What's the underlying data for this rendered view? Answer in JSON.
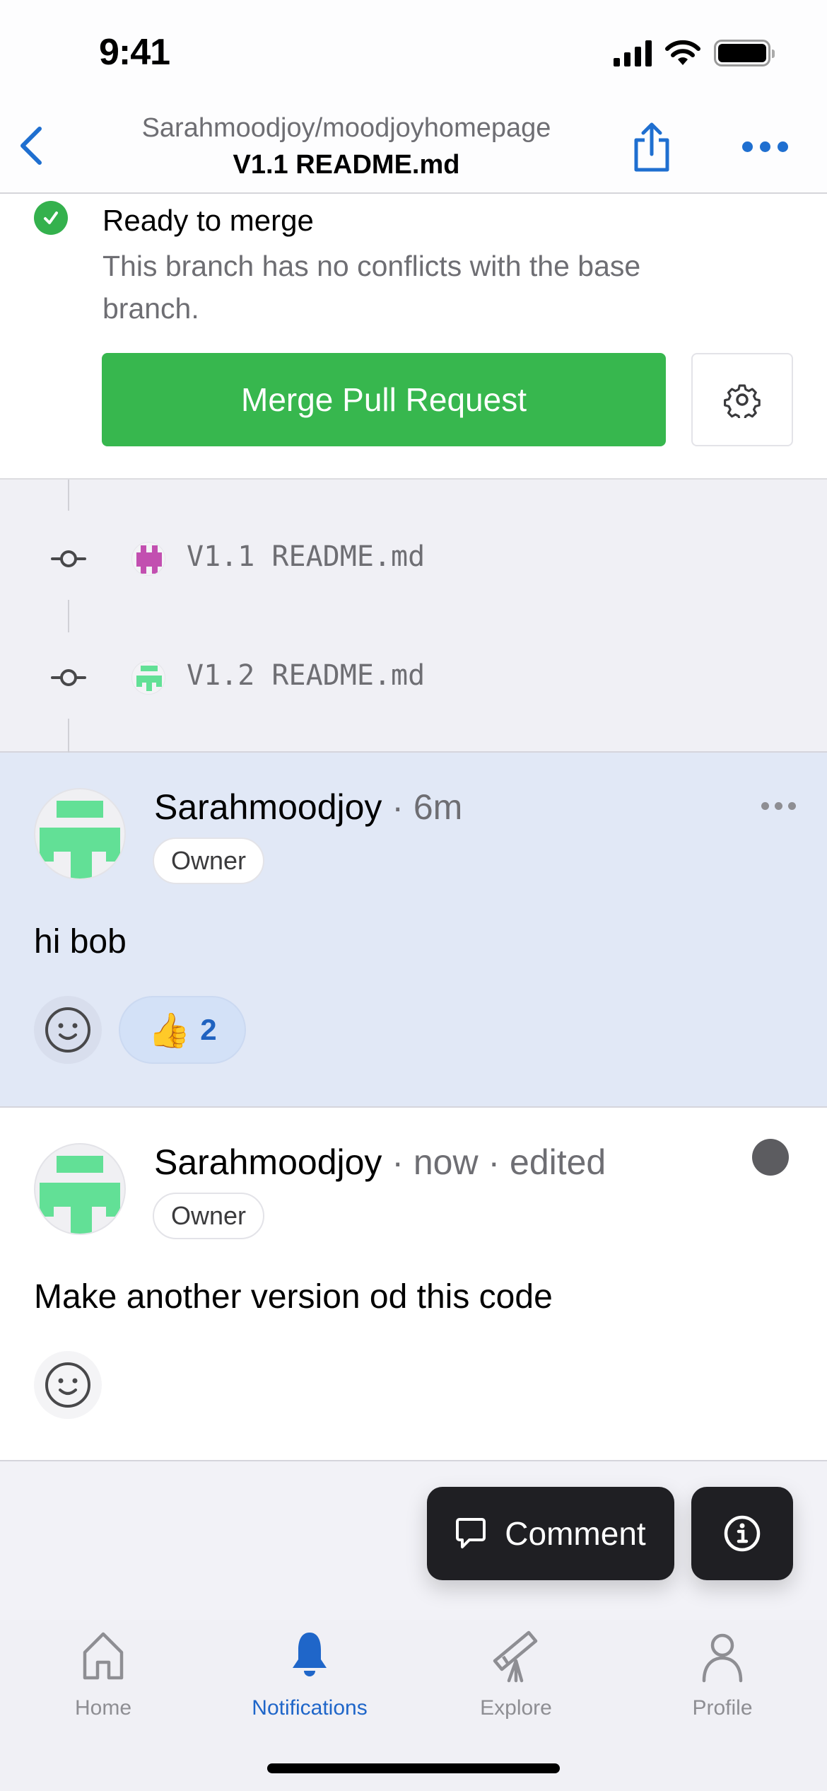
{
  "status_bar": {
    "time": "9:41"
  },
  "nav": {
    "repo": "Sarahmoodjoy/moodjoyhomepage",
    "title": "V1.1 README.md"
  },
  "merge": {
    "status_title": "Ready to merge",
    "status_description": "This branch has no conflicts with the base branch.",
    "merge_button": "Merge Pull Request",
    "accent_color": "#37b74e"
  },
  "commits": [
    {
      "message": "V1.1 README.md",
      "avatar_color": "#c24fb0"
    },
    {
      "message": "V1.2 README.md",
      "avatar_color": "#62e096"
    }
  ],
  "comments": [
    {
      "author": "Sarahmoodjoy",
      "meta": " · 6m",
      "badge": "Owner",
      "body": "hi bob",
      "reactions": [
        {
          "emoji": "👍",
          "count": "2"
        }
      ],
      "highlighted": true
    },
    {
      "author": "Sarahmoodjoy",
      "meta": " · now · edited",
      "badge": "Owner",
      "body": "Make another version od this code",
      "reactions": [],
      "highlighted": false
    }
  ],
  "actions": {
    "comment_label": "Comment"
  },
  "tabs": [
    {
      "label": "Home",
      "icon": "home-icon",
      "active": false
    },
    {
      "label": "Notifications",
      "icon": "bell-icon",
      "active": true
    },
    {
      "label": "Explore",
      "icon": "telescope-icon",
      "active": false
    },
    {
      "label": "Profile",
      "icon": "person-icon",
      "active": false
    }
  ],
  "colors": {
    "link_blue": "#1f6fd0",
    "active_tab": "#1f66c9",
    "highlight_bg": "#e1e8f6"
  }
}
